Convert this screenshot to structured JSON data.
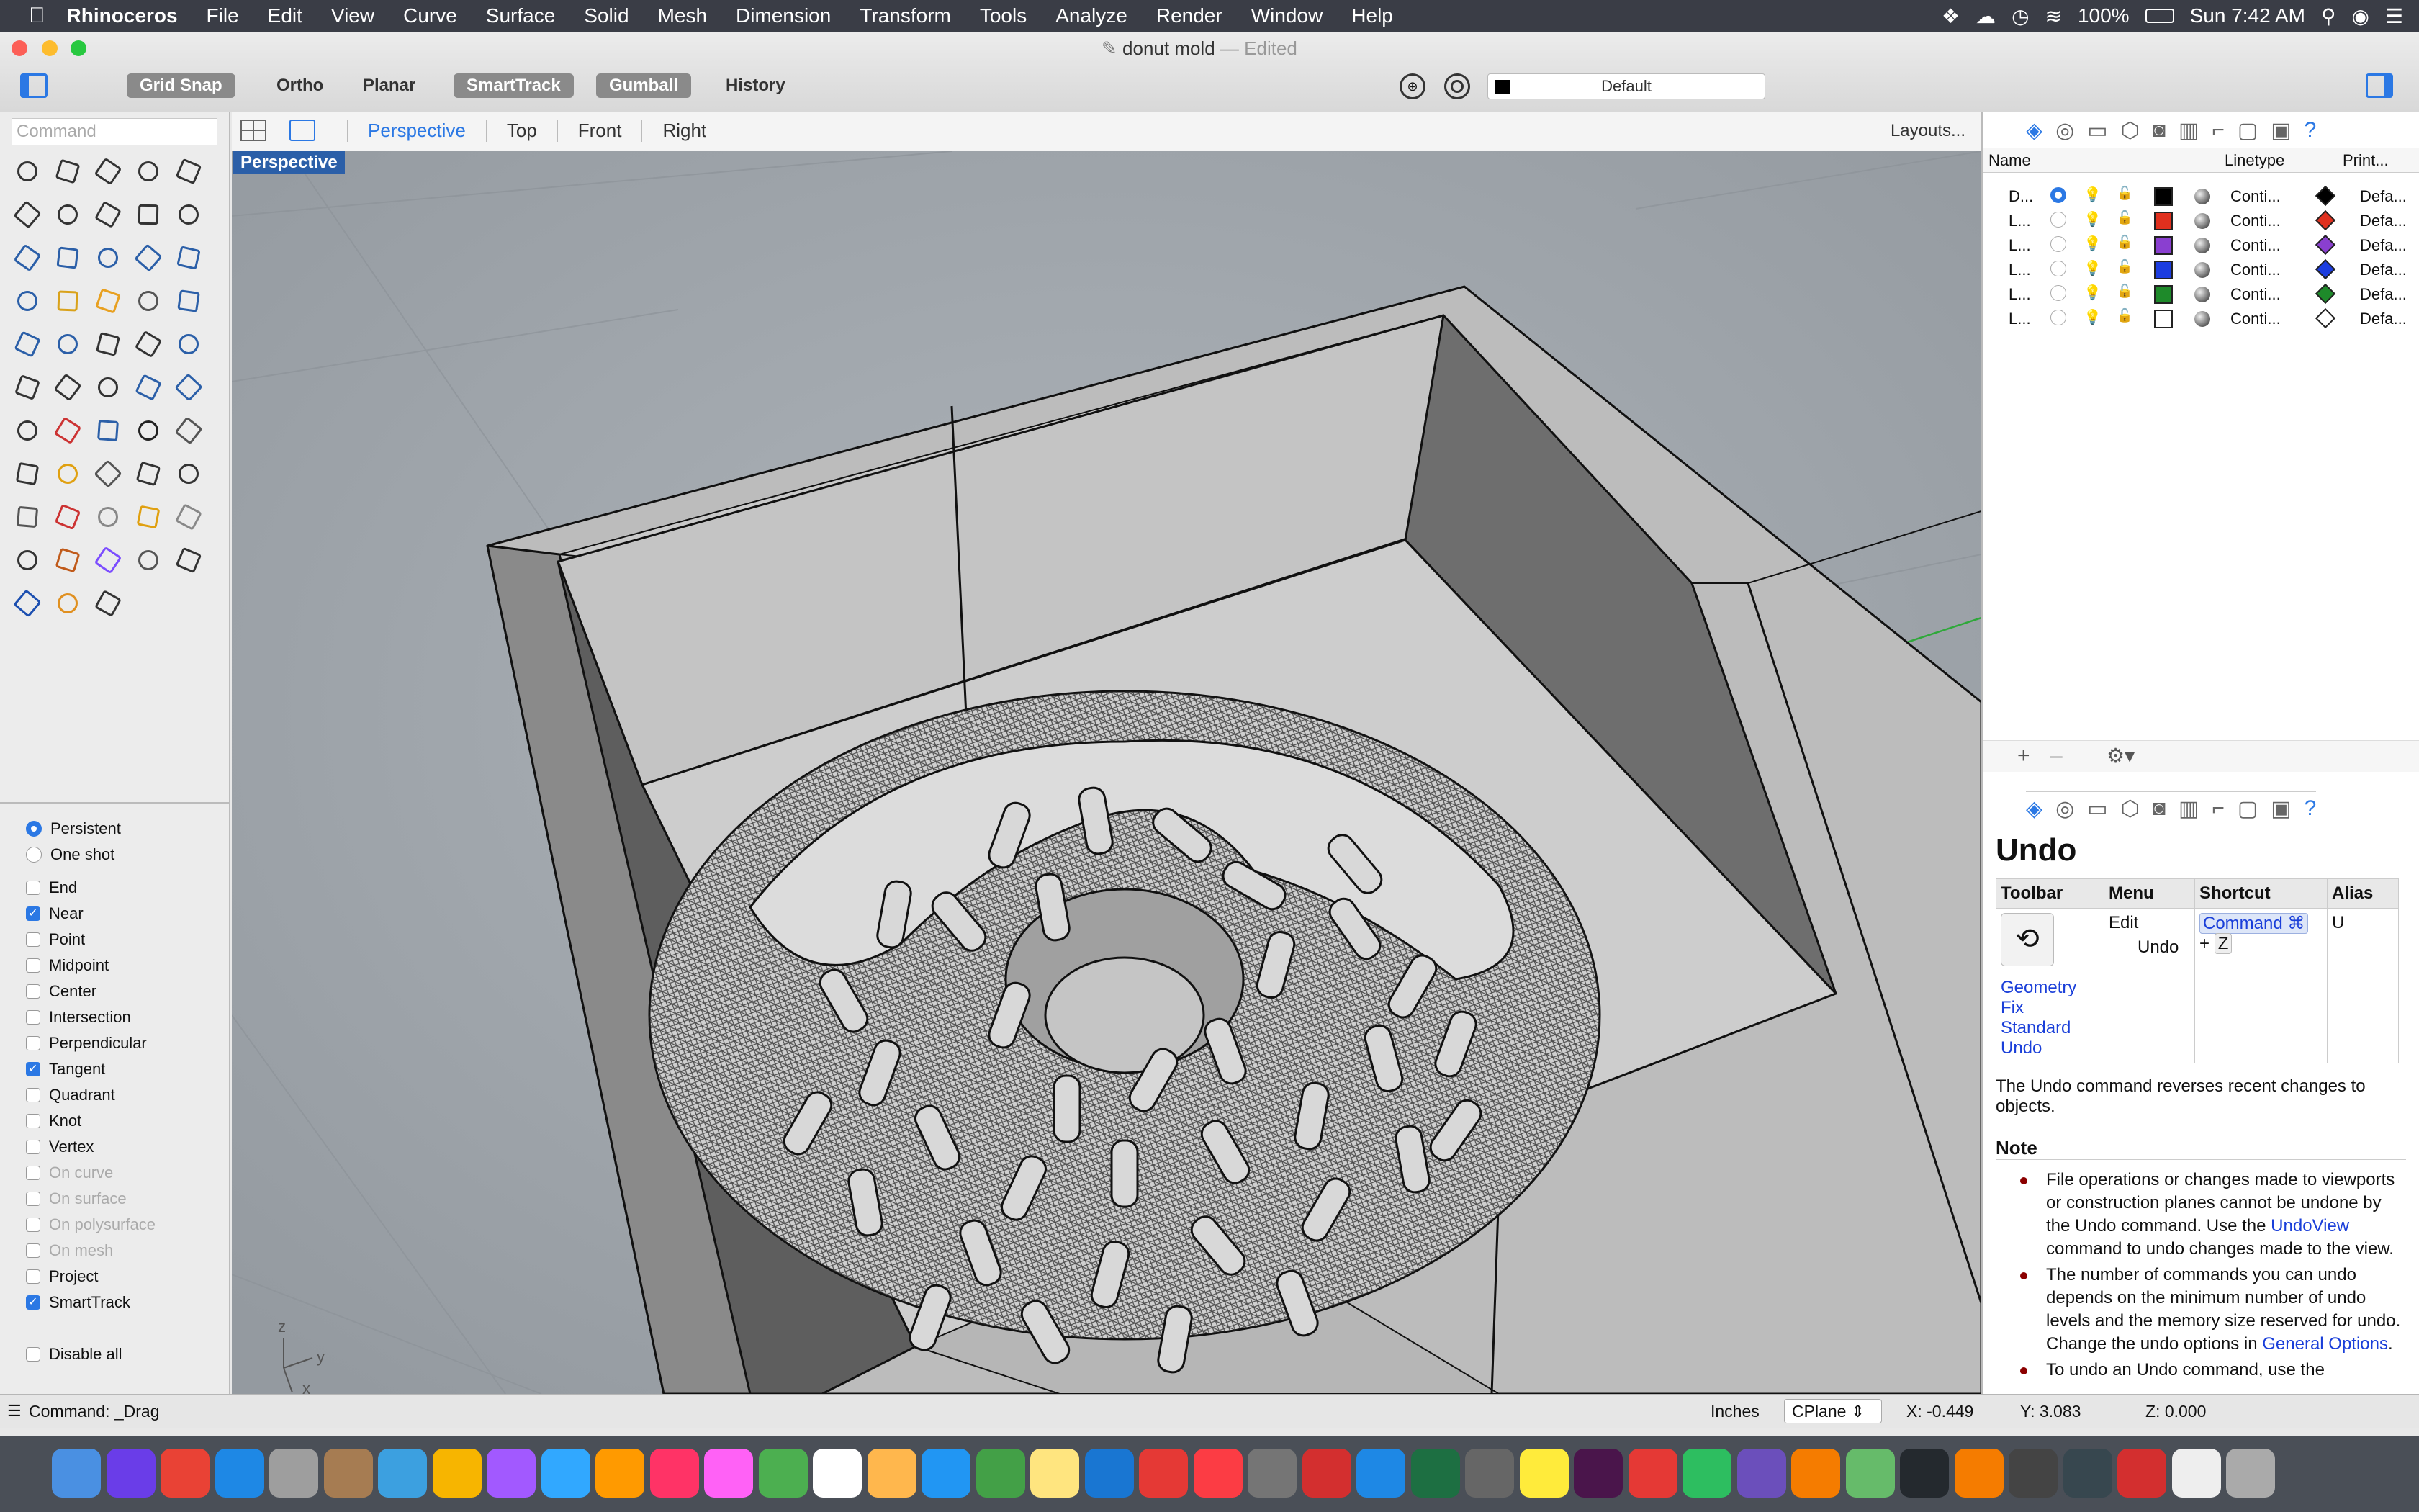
{
  "menubar": {
    "app": "Rhinoceros",
    "items": [
      "File",
      "Edit",
      "View",
      "Curve",
      "Surface",
      "Solid",
      "Mesh",
      "Dimension",
      "Transform",
      "Tools",
      "Analyze",
      "Render",
      "Window",
      "Help"
    ],
    "battery": "100%",
    "clock": "Sun 7:42 AM"
  },
  "window": {
    "title": "donut mold",
    "title_suffix": "— Edited",
    "toolbar_buttons": [
      {
        "label": "Grid Snap",
        "on": true
      },
      {
        "label": "Ortho",
        "on": false
      },
      {
        "label": "Planar",
        "on": false
      },
      {
        "label": "SmartTrack",
        "on": true
      },
      {
        "label": "Gumball",
        "on": true
      },
      {
        "label": "History",
        "on": false
      }
    ],
    "layer_dropdown": "Default"
  },
  "command_placeholder": "Command",
  "viewport_tabs": [
    "Perspective",
    "Top",
    "Front",
    "Right"
  ],
  "active_tab": "Perspective",
  "layouts_label": "Layouts...",
  "viewport_label": "Perspective",
  "axis_labels": {
    "z": "z",
    "y": "y",
    "x": "x"
  },
  "osnap": {
    "modes": [
      {
        "label": "Persistent",
        "selected": true
      },
      {
        "label": "One shot",
        "selected": false
      }
    ],
    "items": [
      {
        "label": "End",
        "checked": false,
        "enabled": true
      },
      {
        "label": "Near",
        "checked": true,
        "enabled": true
      },
      {
        "label": "Point",
        "checked": false,
        "enabled": true
      },
      {
        "label": "Midpoint",
        "checked": false,
        "enabled": true
      },
      {
        "label": "Center",
        "checked": false,
        "enabled": true
      },
      {
        "label": "Intersection",
        "checked": false,
        "enabled": true
      },
      {
        "label": "Perpendicular",
        "checked": false,
        "enabled": true
      },
      {
        "label": "Tangent",
        "checked": true,
        "enabled": true
      },
      {
        "label": "Quadrant",
        "checked": false,
        "enabled": true
      },
      {
        "label": "Knot",
        "checked": false,
        "enabled": true
      },
      {
        "label": "Vertex",
        "checked": false,
        "enabled": true
      },
      {
        "label": "On curve",
        "checked": false,
        "enabled": false
      },
      {
        "label": "On surface",
        "checked": false,
        "enabled": false
      },
      {
        "label": "On polysurface",
        "checked": false,
        "enabled": false
      },
      {
        "label": "On mesh",
        "checked": false,
        "enabled": false
      },
      {
        "label": "Project",
        "checked": false,
        "enabled": true
      },
      {
        "label": "SmartTrack",
        "checked": true,
        "enabled": true
      }
    ],
    "disable_all": "Disable all"
  },
  "layers": {
    "headers": {
      "name": "Name",
      "linetype": "Linetype",
      "print": "Print..."
    },
    "rows": [
      {
        "name": "D...",
        "current": true,
        "color": "#000000",
        "linetype": "Conti...",
        "print": "Defa...",
        "pcolor": "#000000"
      },
      {
        "name": "L...",
        "current": false,
        "color": "#e0301e",
        "linetype": "Conti...",
        "print": "Defa...",
        "pcolor": "#e0301e"
      },
      {
        "name": "L...",
        "current": false,
        "color": "#8a3fd0",
        "linetype": "Conti...",
        "print": "Defa...",
        "pcolor": "#8a3fd0"
      },
      {
        "name": "L...",
        "current": false,
        "color": "#1c3de0",
        "linetype": "Conti...",
        "print": "Defa...",
        "pcolor": "#1c3de0"
      },
      {
        "name": "L...",
        "current": false,
        "color": "#1e8a2a",
        "linetype": "Conti...",
        "print": "Defa...",
        "pcolor": "#1e8a2a"
      },
      {
        "name": "L...",
        "current": false,
        "color": "#ffffff",
        "linetype": "Conti...",
        "print": "Defa...",
        "pcolor": "#ffffff"
      }
    ]
  },
  "help": {
    "title": "Undo",
    "table_headers": [
      "Toolbar",
      "Menu",
      "Shortcut",
      "Alias"
    ],
    "menu_lines": [
      "Edit",
      "Undo"
    ],
    "shortcut_key1": "Command ⌘",
    "shortcut_plus": "+",
    "shortcut_key2": "Z",
    "alias": "U",
    "toolbar_links": [
      "Geometry",
      "Fix",
      "Standard",
      "Undo"
    ],
    "description": "The Undo command reverses recent changes to objects.",
    "note_heading": "Note",
    "notes": [
      {
        "pre": "File operations or changes made to viewports or construction planes cannot be undone by the Undo command. Use the ",
        "link": "UndoView",
        "post": " command to undo changes made to the view."
      },
      {
        "pre": "The number of commands you can undo depends on the minimum number of undo levels and the memory size reserved for undo. Change the undo options in ",
        "link": "General Options",
        "post": "."
      },
      {
        "pre": "To undo an Undo command, use the",
        "link": "",
        "post": ""
      }
    ]
  },
  "statusbar": {
    "command": "Command: _Drag",
    "units": "Inches",
    "cplane": "CPlane",
    "x": "X: -0.449",
    "y": "Y: 3.083",
    "z": "Z: 0.000"
  },
  "dock_apps": [
    "Finder",
    "Siri",
    "Chrome",
    "Safari",
    "Launchpad",
    "Archive",
    "Preview",
    "Sketch",
    "Figma",
    "Photoshop",
    "Illustrator",
    "InDesign",
    "XD",
    "Maps",
    "Calendar",
    "Photos",
    "Messages",
    "FaceTime",
    "Notes",
    "Keynote",
    "Notability",
    "Music",
    "System Preferences",
    "Acrobat",
    "App Store",
    "Excel",
    "Scripts",
    "Stickies",
    "Slack",
    "Bookmark",
    "Evernote",
    "Paw",
    "Fusion",
    "Atom",
    "GitHub",
    "Fusion 360",
    "Rhino",
    "Toolbox",
    "Red",
    "Transmit",
    "Trash"
  ]
}
